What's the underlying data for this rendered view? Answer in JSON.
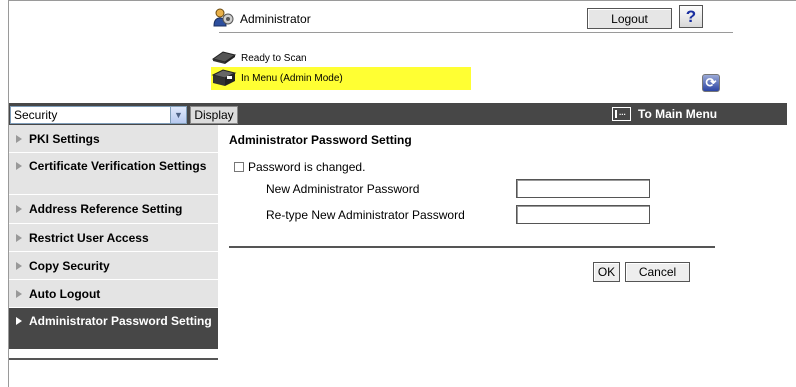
{
  "header": {
    "user_label": "Administrator",
    "logout_label": "Logout",
    "help_label": "?",
    "status_ready": "Ready to Scan",
    "status_menu": "In Menu (Admin Mode)",
    "refresh_label": "⟳"
  },
  "nav": {
    "category_selected": "Security",
    "display_label": "Display",
    "main_menu_label": "To Main Menu"
  },
  "sidebar": {
    "items": [
      {
        "label": "PKI Settings"
      },
      {
        "label": "Certificate Verification Settings"
      },
      {
        "label": "Address Reference Setting"
      },
      {
        "label": "Restrict User Access"
      },
      {
        "label": "Copy Security"
      },
      {
        "label": "Auto Logout"
      },
      {
        "label": "Administrator Password Setting"
      }
    ]
  },
  "main": {
    "title": "Administrator Password Setting",
    "checkbox_label": "Password is changed.",
    "new_password_label": "New Administrator Password",
    "retype_password_label": "Re-type New Administrator Password",
    "ok_label": "OK",
    "cancel_label": "Cancel"
  },
  "colors": {
    "nav_bar": "#474747",
    "status_highlight": "#ffff33",
    "sidebar_bg": "#e4e4e4",
    "sidebar_active": "#474747"
  }
}
